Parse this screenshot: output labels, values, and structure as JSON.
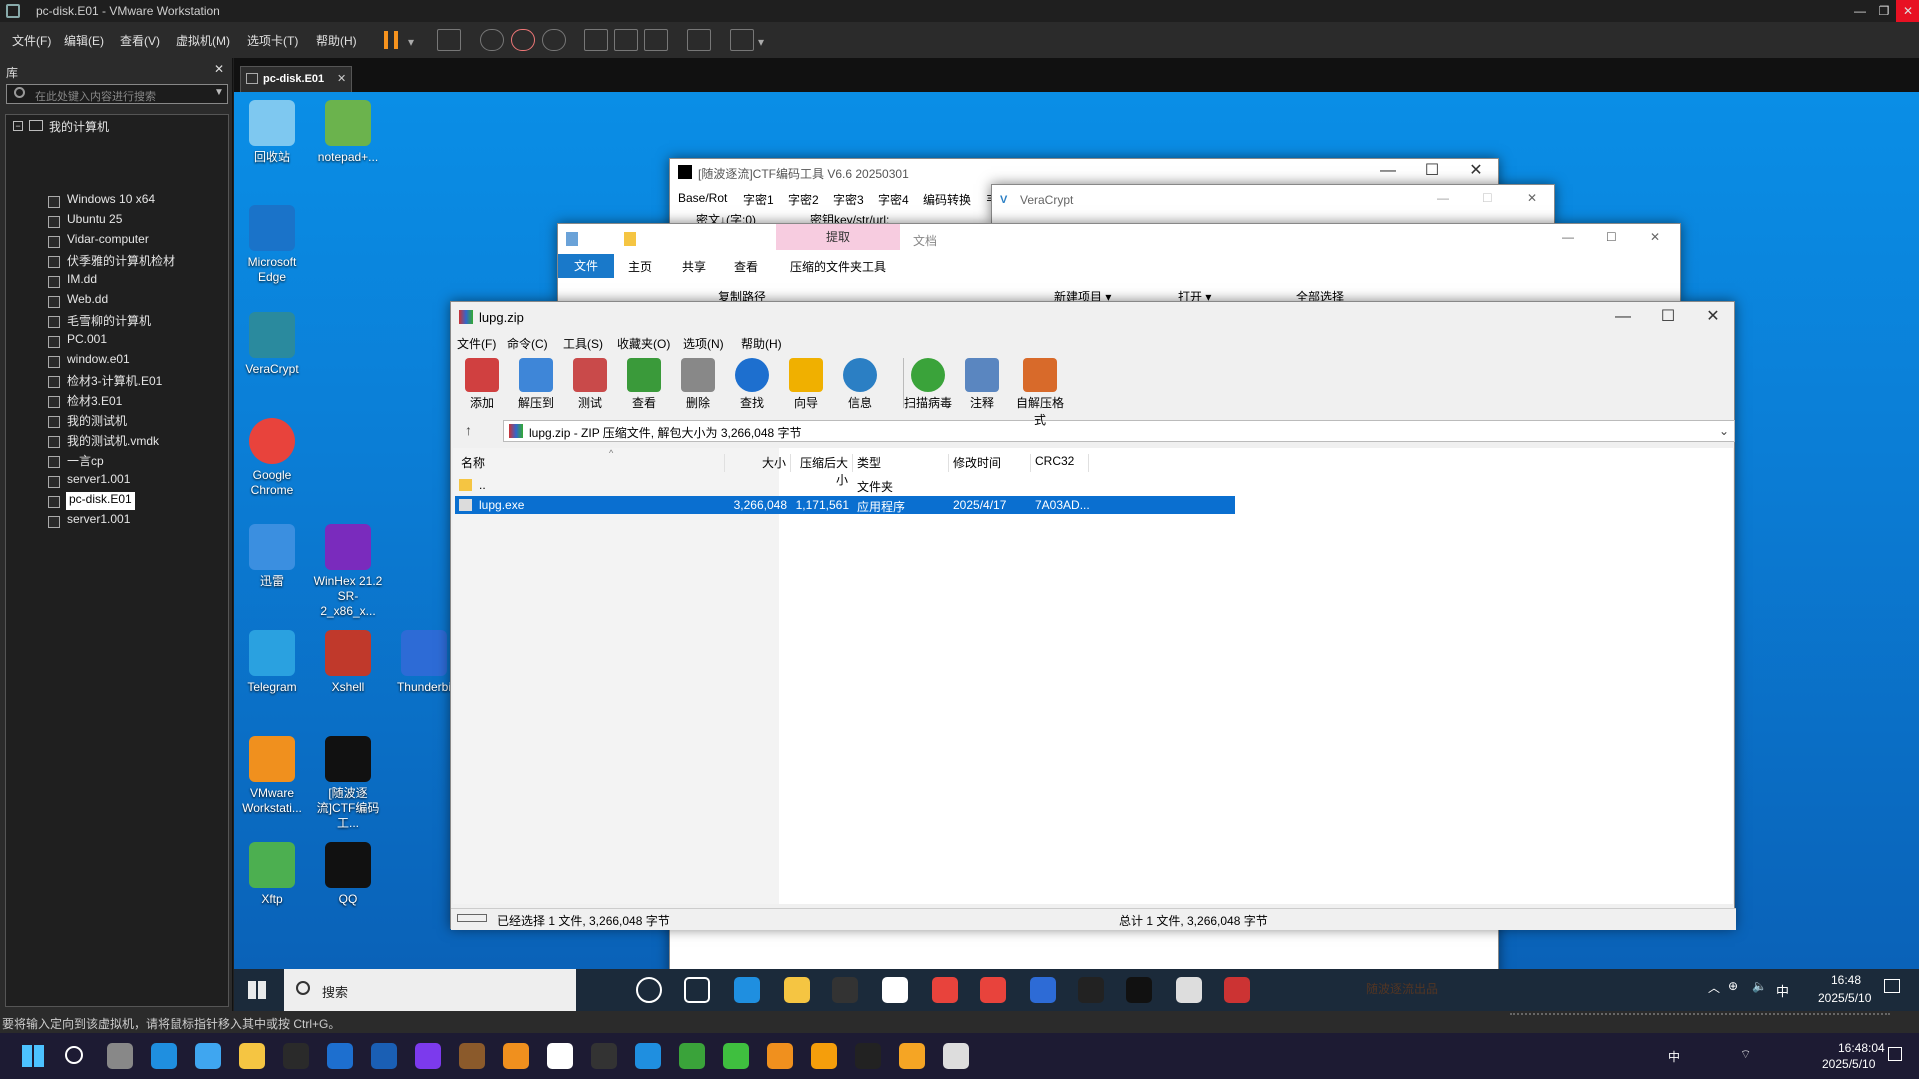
{
  "vm": {
    "title": "pc-disk.E01 - VMware Workstation",
    "menu": [
      "文件(F)",
      "编辑(E)",
      "查看(V)",
      "虚拟机(M)",
      "选项卡(T)",
      "帮助(H)"
    ],
    "library_title": "库",
    "search_placeholder": "在此处键入内容进行搜索",
    "tree_root": "我的计算机",
    "tree_items": [
      "Windows 10 x64",
      "Ubuntu 25",
      "Vidar-computer",
      "伏季雅的计算机检材",
      "IM.dd",
      "Web.dd",
      "毛雪柳的计算机",
      "PC.001",
      "window.e01",
      "检材3-计算机.E01",
      "检材3.E01",
      "我的测试机",
      "我的测试机.vmdk",
      "一言cp",
      "server1.001",
      "pc-disk.E01",
      "server1.001"
    ],
    "selected_tree_item": "pc-disk.E01",
    "tab_label": "pc-disk.E01",
    "status_text": "要将输入定向到该虚拟机，请将鼠标指针移入其中或按 Ctrl+G。"
  },
  "desktop": {
    "icons": [
      {
        "label": "回收站"
      },
      {
        "label": "notepad+..."
      },
      {
        "label": "Microsoft Edge"
      },
      {
        "label": "VeraCrypt"
      },
      {
        "label": "Google Chrome"
      },
      {
        "label": "迅雷"
      },
      {
        "label": "WinHex 21.2 SR-2_x86_x..."
      },
      {
        "label": "Telegram"
      },
      {
        "label": "Xshell"
      },
      {
        "label": "Thunderbi"
      },
      {
        "label": "VMware Workstati..."
      },
      {
        "label": "[随波逐流]CTF编码工..."
      },
      {
        "label": "Xftp"
      },
      {
        "label": "QQ"
      }
    ]
  },
  "ctf_window": {
    "title": "[随波逐流]CTF编码工具 V6.6 20250301",
    "menu": [
      "Base/Rot",
      "字密1",
      "字密2",
      "字密3",
      "字密4",
      "编码转换",
      "韦"
    ],
    "row2": "密文↓(字:0)",
    "row2b": "密钥key/str/url:"
  },
  "veracrypt_window": {
    "title": "VeraCrypt"
  },
  "explorer_window": {
    "ribbon_context": "提取",
    "doc_label": "文档",
    "tabs": [
      "文件",
      "主页",
      "共享",
      "查看",
      "压缩的文件夹工具"
    ],
    "actions": [
      "复制路径",
      "新建项目 ▾",
      "打开 ▾",
      "全部选择"
    ]
  },
  "winrar": {
    "title": "lupg.zip",
    "menu": [
      "文件(F)",
      "命令(C)",
      "工具(S)",
      "收藏夹(O)",
      "选项(N)",
      "帮助(H)"
    ],
    "toolbar": [
      "添加",
      "解压到",
      "测试",
      "查看",
      "删除",
      "查找",
      "向导",
      "信息",
      "扫描病毒",
      "注释",
      "自解压格式"
    ],
    "path": "lupg.zip - ZIP 压缩文件, 解包大小为 3,266,048 字节",
    "columns": [
      "名称",
      "大小",
      "压缩后大小",
      "类型",
      "修改时间",
      "CRC32"
    ],
    "rows": [
      {
        "name": "..",
        "size": "",
        "packed": "",
        "type": "文件夹",
        "mtime": "",
        "crc": ""
      },
      {
        "name": "lupg.exe",
        "size": "3,266,048",
        "packed": "1,171,561",
        "type": "应用程序",
        "mtime": "2025/4/17 16...",
        "crc": "7A03AD..."
      }
    ],
    "status_left": "已经选择 1 文件, 3,266,048 字节",
    "status_right": "总计 1 文件, 3,266,048 字节"
  },
  "guest_taskbar": {
    "search": "搜索",
    "time": "16:48",
    "date": "2025/5/10",
    "ime": "中",
    "tray_text": "随波逐流出品"
  },
  "host_taskbar": {
    "time": "16:48:04",
    "date": "2025/5/10",
    "ime": "中"
  }
}
